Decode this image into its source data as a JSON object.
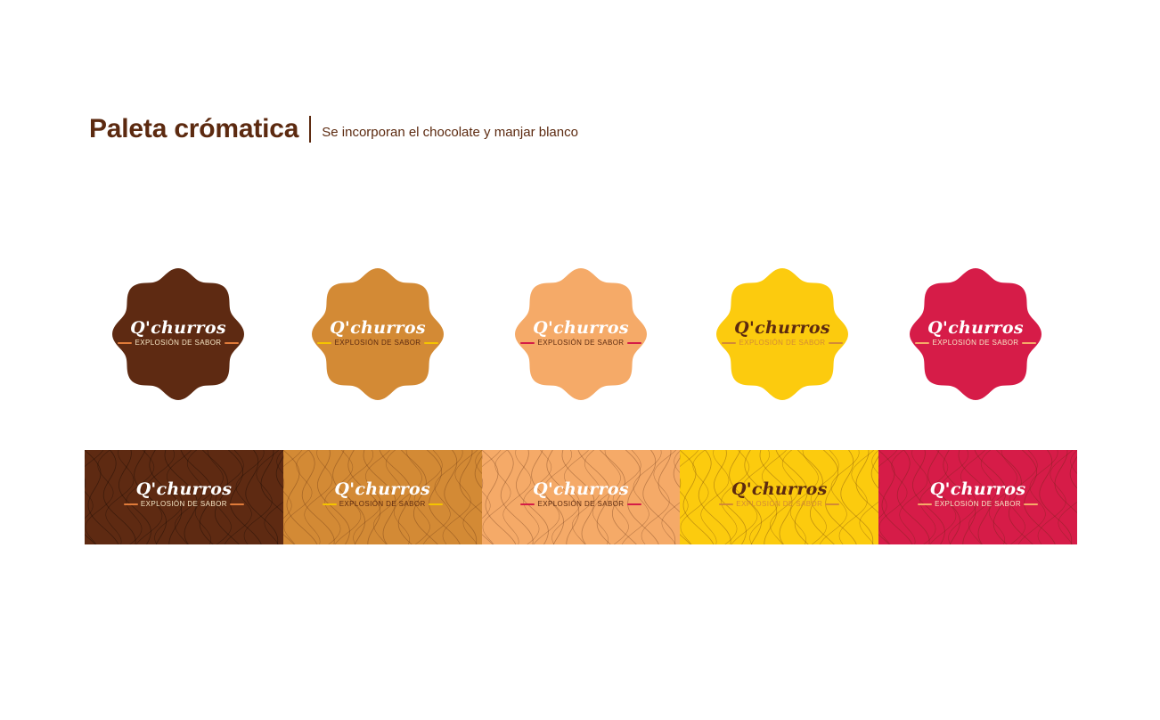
{
  "header": {
    "title": "Paleta crómatica",
    "subtitle": "Se incorporan el chocolate y manjar blanco"
  },
  "logo": {
    "name": "Q'churros",
    "tagline": "EXPLOSIÓN DE SABOR"
  },
  "swatches": [
    {
      "bg": "#5e2a12",
      "text": "#ffffff",
      "tagline": "#f7e7c6",
      "dash": "#e07b3a"
    },
    {
      "bg": "#d38a35",
      "text": "#ffffff",
      "tagline": "#5c2a10",
      "dash": "#f5c400"
    },
    {
      "bg": "#f5aa68",
      "text": "#ffffff",
      "tagline": "#5c2a10",
      "dash": "#d41c46"
    },
    {
      "bg": "#fccb0e",
      "text": "#5c2a10",
      "tagline": "#d38a35",
      "dash": "#d38a35"
    },
    {
      "bg": "#d61c48",
      "text": "#ffffff",
      "tagline": "#f7e7c6",
      "dash": "#f5aa68"
    }
  ]
}
